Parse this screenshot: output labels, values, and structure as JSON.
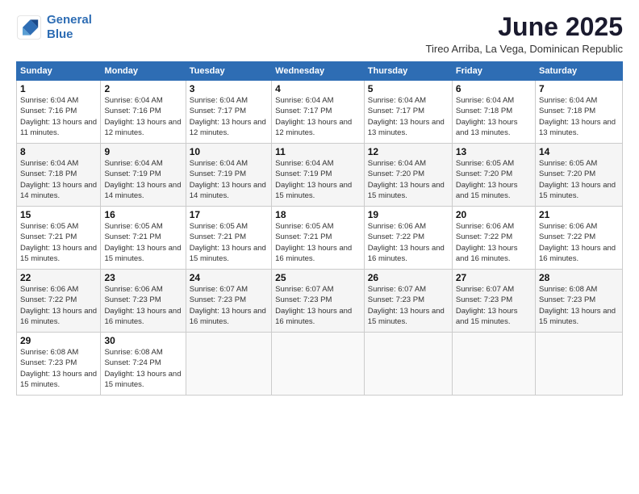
{
  "logo": {
    "line1": "General",
    "line2": "Blue"
  },
  "title": "June 2025",
  "subtitle": "Tireo Arriba, La Vega, Dominican Republic",
  "days_of_week": [
    "Sunday",
    "Monday",
    "Tuesday",
    "Wednesday",
    "Thursday",
    "Friday",
    "Saturday"
  ],
  "weeks": [
    [
      {
        "num": "1",
        "sunrise": "6:04 AM",
        "sunset": "7:16 PM",
        "daylight": "13 hours and 11 minutes."
      },
      {
        "num": "2",
        "sunrise": "6:04 AM",
        "sunset": "7:16 PM",
        "daylight": "13 hours and 12 minutes."
      },
      {
        "num": "3",
        "sunrise": "6:04 AM",
        "sunset": "7:17 PM",
        "daylight": "13 hours and 12 minutes."
      },
      {
        "num": "4",
        "sunrise": "6:04 AM",
        "sunset": "7:17 PM",
        "daylight": "13 hours and 12 minutes."
      },
      {
        "num": "5",
        "sunrise": "6:04 AM",
        "sunset": "7:17 PM",
        "daylight": "13 hours and 13 minutes."
      },
      {
        "num": "6",
        "sunrise": "6:04 AM",
        "sunset": "7:18 PM",
        "daylight": "13 hours and 13 minutes."
      },
      {
        "num": "7",
        "sunrise": "6:04 AM",
        "sunset": "7:18 PM",
        "daylight": "13 hours and 13 minutes."
      }
    ],
    [
      {
        "num": "8",
        "sunrise": "6:04 AM",
        "sunset": "7:18 PM",
        "daylight": "13 hours and 14 minutes."
      },
      {
        "num": "9",
        "sunrise": "6:04 AM",
        "sunset": "7:19 PM",
        "daylight": "13 hours and 14 minutes."
      },
      {
        "num": "10",
        "sunrise": "6:04 AM",
        "sunset": "7:19 PM",
        "daylight": "13 hours and 14 minutes."
      },
      {
        "num": "11",
        "sunrise": "6:04 AM",
        "sunset": "7:19 PM",
        "daylight": "13 hours and 15 minutes."
      },
      {
        "num": "12",
        "sunrise": "6:04 AM",
        "sunset": "7:20 PM",
        "daylight": "13 hours and 15 minutes."
      },
      {
        "num": "13",
        "sunrise": "6:05 AM",
        "sunset": "7:20 PM",
        "daylight": "13 hours and 15 minutes."
      },
      {
        "num": "14",
        "sunrise": "6:05 AM",
        "sunset": "7:20 PM",
        "daylight": "13 hours and 15 minutes."
      }
    ],
    [
      {
        "num": "15",
        "sunrise": "6:05 AM",
        "sunset": "7:21 PM",
        "daylight": "13 hours and 15 minutes."
      },
      {
        "num": "16",
        "sunrise": "6:05 AM",
        "sunset": "7:21 PM",
        "daylight": "13 hours and 15 minutes."
      },
      {
        "num": "17",
        "sunrise": "6:05 AM",
        "sunset": "7:21 PM",
        "daylight": "13 hours and 15 minutes."
      },
      {
        "num": "18",
        "sunrise": "6:05 AM",
        "sunset": "7:21 PM",
        "daylight": "13 hours and 16 minutes."
      },
      {
        "num": "19",
        "sunrise": "6:06 AM",
        "sunset": "7:22 PM",
        "daylight": "13 hours and 16 minutes."
      },
      {
        "num": "20",
        "sunrise": "6:06 AM",
        "sunset": "7:22 PM",
        "daylight": "13 hours and 16 minutes."
      },
      {
        "num": "21",
        "sunrise": "6:06 AM",
        "sunset": "7:22 PM",
        "daylight": "13 hours and 16 minutes."
      }
    ],
    [
      {
        "num": "22",
        "sunrise": "6:06 AM",
        "sunset": "7:22 PM",
        "daylight": "13 hours and 16 minutes."
      },
      {
        "num": "23",
        "sunrise": "6:06 AM",
        "sunset": "7:23 PM",
        "daylight": "13 hours and 16 minutes."
      },
      {
        "num": "24",
        "sunrise": "6:07 AM",
        "sunset": "7:23 PM",
        "daylight": "13 hours and 16 minutes."
      },
      {
        "num": "25",
        "sunrise": "6:07 AM",
        "sunset": "7:23 PM",
        "daylight": "13 hours and 16 minutes."
      },
      {
        "num": "26",
        "sunrise": "6:07 AM",
        "sunset": "7:23 PM",
        "daylight": "13 hours and 15 minutes."
      },
      {
        "num": "27",
        "sunrise": "6:07 AM",
        "sunset": "7:23 PM",
        "daylight": "13 hours and 15 minutes."
      },
      {
        "num": "28",
        "sunrise": "6:08 AM",
        "sunset": "7:23 PM",
        "daylight": "13 hours and 15 minutes."
      }
    ],
    [
      {
        "num": "29",
        "sunrise": "6:08 AM",
        "sunset": "7:23 PM",
        "daylight": "13 hours and 15 minutes."
      },
      {
        "num": "30",
        "sunrise": "6:08 AM",
        "sunset": "7:24 PM",
        "daylight": "13 hours and 15 minutes."
      },
      null,
      null,
      null,
      null,
      null
    ]
  ]
}
